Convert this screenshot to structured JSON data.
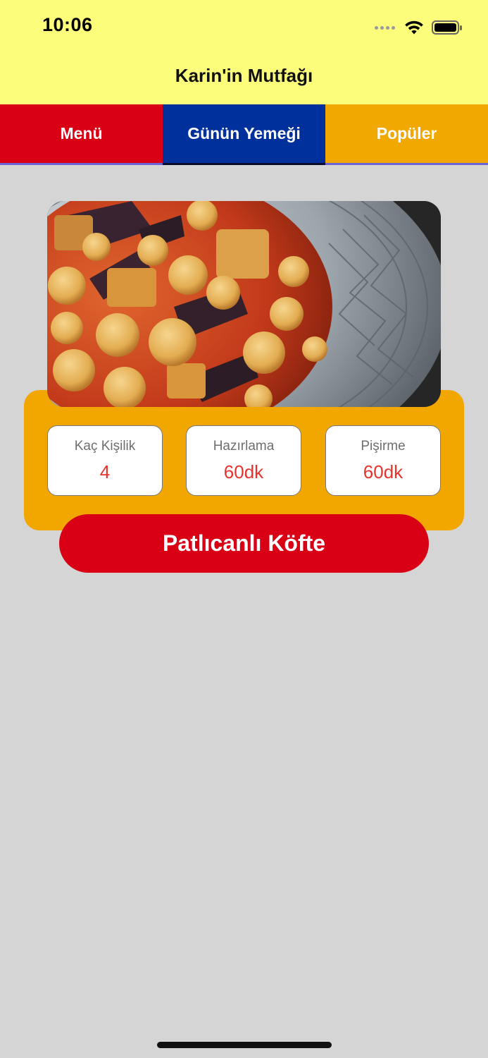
{
  "status_bar": {
    "time": "10:06",
    "icons": [
      "cellular-signal-icon",
      "wifi-icon",
      "battery-icon"
    ]
  },
  "app": {
    "title": "Karin'in Mutfağı"
  },
  "tabs": [
    {
      "label": "Menü",
      "color": "#d90016"
    },
    {
      "label": "Günün Yemeği",
      "color": "#00309b",
      "selected": true
    },
    {
      "label": "Popüler",
      "color": "#f1a800"
    }
  ],
  "dish": {
    "name": "Patlıcanlı Köfte",
    "photo": "food-photo",
    "info": [
      {
        "label": "Kaç Kişilik",
        "value": "4"
      },
      {
        "label": "Hazırlama",
        "value": "60dk"
      },
      {
        "label": "Pişirme",
        "value": "60dk"
      }
    ]
  },
  "colors": {
    "header_bg": "#fdfd7c",
    "page_bg": "#d5d5d5",
    "accent_red": "#d90016",
    "accent_blue": "#00309b",
    "accent_orange": "#f1a800",
    "value_text": "#e8332c"
  }
}
